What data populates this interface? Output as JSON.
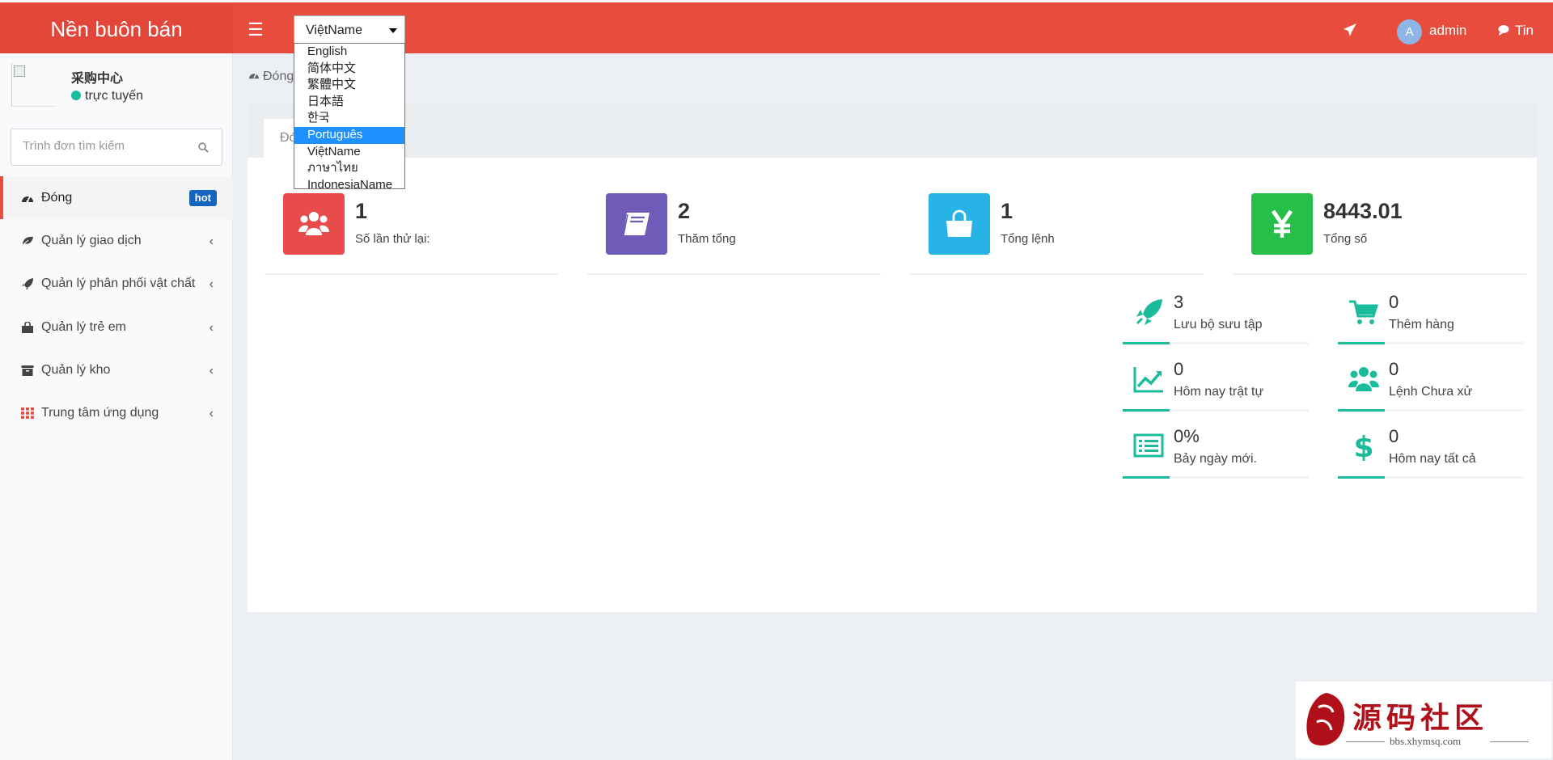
{
  "header": {
    "brand": "Nền buôn bán",
    "language": {
      "selected": "ViệtName",
      "options": [
        "English",
        "简体中文",
        "繁體中文",
        "日本語",
        "한국",
        "Português",
        "ViệtName",
        "ภาษาไทย",
        "IndonesiaName"
      ],
      "highlighted": "Português"
    },
    "user_initial": "A",
    "user_name": "admin",
    "messages_label": "Tin"
  },
  "sidebar": {
    "user": {
      "name": "采购中心",
      "status": "trực tuyến"
    },
    "search_placeholder": "Trình đơn tìm kiếm",
    "items": [
      {
        "label": "Đóng",
        "badge": "hot",
        "icon": "dashboard-icon"
      },
      {
        "label": "Quản lý giao dịch",
        "icon": "leaf-icon"
      },
      {
        "label": "Quản lý phân phối vật chất",
        "icon": "rocket-icon"
      },
      {
        "label": "Quản lý trẻ em",
        "icon": "bag-icon"
      },
      {
        "label": "Quản lý kho",
        "icon": "archive-icon"
      },
      {
        "label": "Trung tâm ứng dụng",
        "icon": "grid-icon"
      }
    ]
  },
  "breadcrumb": "Đóng",
  "tab_label": "Đóng",
  "stats": [
    {
      "value": "1",
      "label": "Số lần thử lại:",
      "color": "#e84c4a",
      "icon": "users-icon"
    },
    {
      "value": "2",
      "label": "Thăm tổng",
      "color": "#6f5bb8",
      "icon": "book-icon"
    },
    {
      "value": "1",
      "label": "Tổng lệnh",
      "color": "#27b3e5",
      "icon": "shopping-bag-icon"
    },
    {
      "value": "8443.01",
      "label": "Tổng số",
      "color": "#27bf4a",
      "icon": "yen-icon"
    }
  ],
  "mini_stats": [
    {
      "value": "3",
      "label": "Lưu bộ sưu tập",
      "icon": "rocket-icon"
    },
    {
      "value": "0",
      "label": "Thêm hàng",
      "icon": "cart-icon"
    },
    {
      "value": "0",
      "label": "Hôm nay trật tự",
      "icon": "line-chart-icon"
    },
    {
      "value": "0",
      "label": "Lệnh Chưa xử",
      "icon": "users-icon"
    },
    {
      "value": "0%",
      "label": "Bảy ngày mới.",
      "icon": "list-icon"
    },
    {
      "value": "0",
      "label": "Hôm nay tất cả",
      "icon": "dollar-icon"
    }
  ],
  "watermark": {
    "text": "源码社区",
    "url": "bbs.xhymsq.com"
  }
}
